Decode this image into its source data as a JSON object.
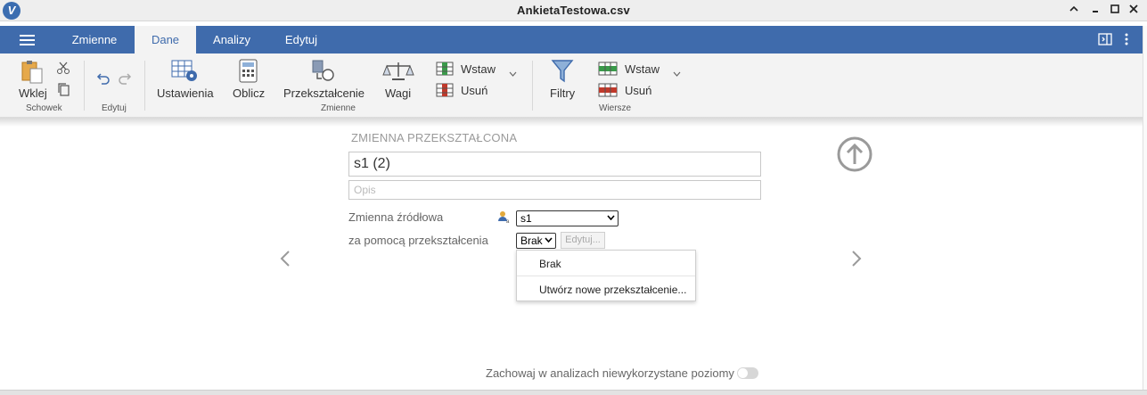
{
  "window": {
    "title": "AnkietaTestowa.csv",
    "logo": "V"
  },
  "tabs": [
    "Zmienne",
    "Dane",
    "Analizy",
    "Edytuj"
  ],
  "active_tab": "Dane",
  "ribbon": {
    "paste": "Wklej",
    "clipboard_group": "Schowek",
    "edit_group": "Edytuj",
    "settings": "Ustawienia",
    "compute": "Oblicz",
    "transform": "Przekształcenie",
    "weights": "Wagi",
    "var_insert": "Wstaw",
    "var_delete": "Usuń",
    "variables_group": "Zmienne",
    "filters": "Filtry",
    "row_insert": "Wstaw",
    "row_delete": "Usuń",
    "rows_group": "Wiersze"
  },
  "form": {
    "heading": "ZMIENNA PRZEKSZTAŁCONA",
    "name_value": "s1 (2)",
    "desc_placeholder": "Opis",
    "source_label": "Zmienna źródłowa",
    "source_value": "s1",
    "transform_label": "za pomocą przekształcenia",
    "transform_value": "Brak",
    "edit_button": "Edytuj...",
    "dropdown_options": [
      "Brak",
      "Utwórz nowe przekształcenie..."
    ],
    "keep_unused_label": "Zachowaj w analizach niewykorzystane poziomy",
    "keep_unused_on": false
  },
  "colors": {
    "brand": "#3f6bac",
    "ribbon_bg": "#f3f3f3",
    "muted": "#9a9a9a"
  }
}
